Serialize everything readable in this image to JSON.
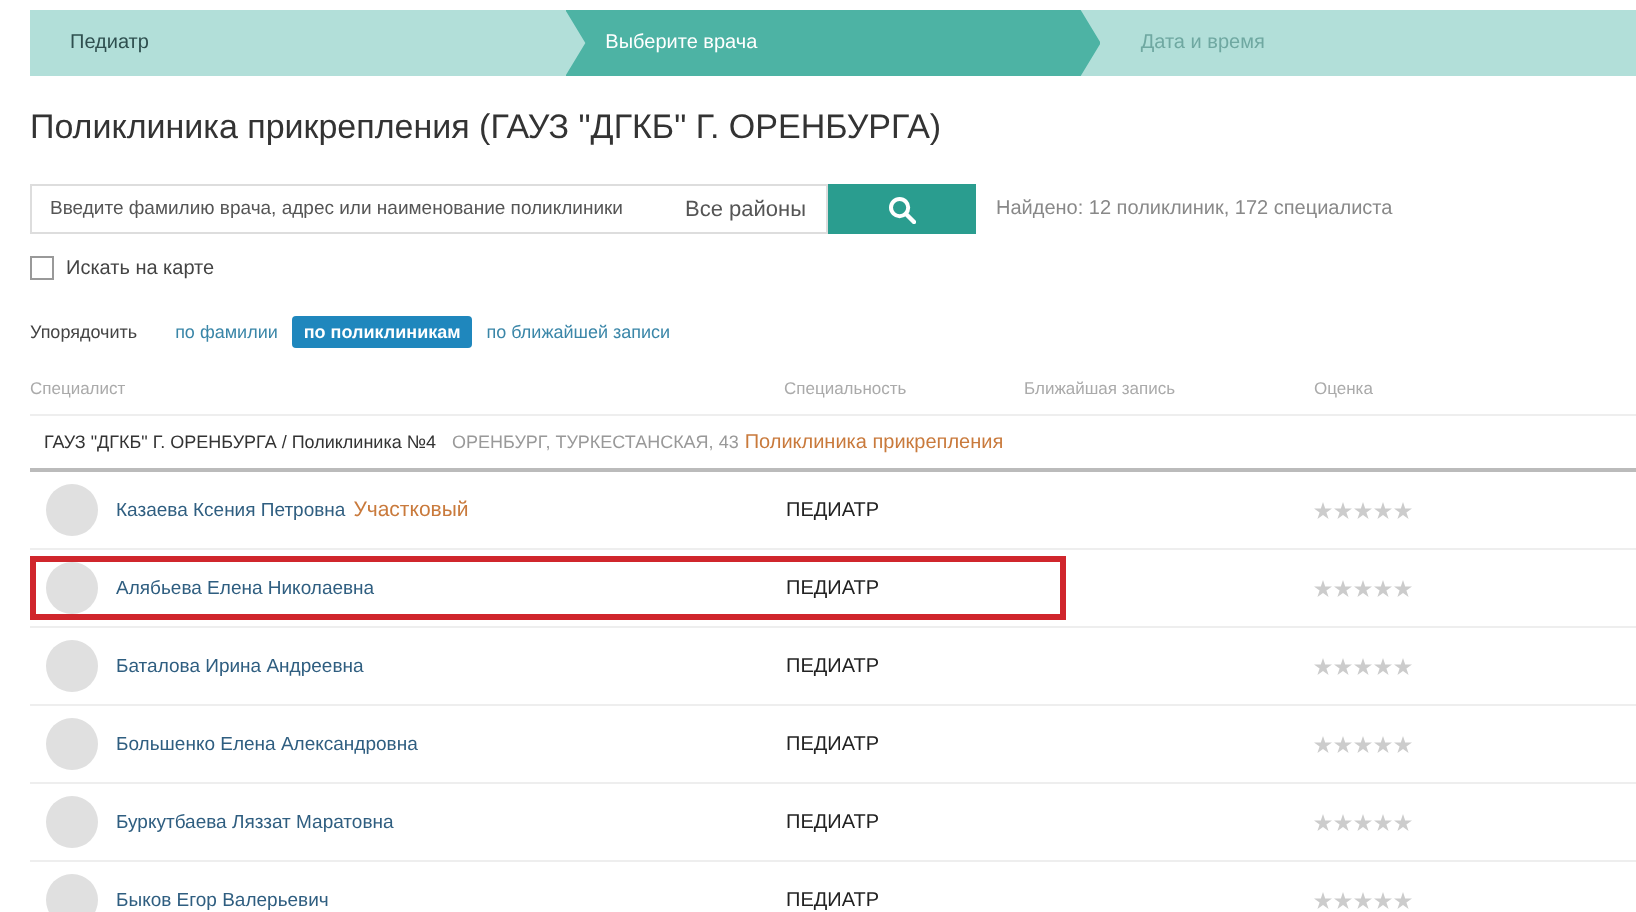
{
  "steps": [
    {
      "label": "Педиатр",
      "selected": false,
      "disabled": false
    },
    {
      "label": "Выберите врача",
      "selected": true,
      "disabled": false
    },
    {
      "label": "Дата и время",
      "selected": false,
      "disabled": true
    }
  ],
  "title": "Поликлиника прикрепления (ГАУЗ \"ДГКБ\" Г. ОРЕНБУРГА)",
  "search": {
    "placeholder": "Введите фамилию врача, адрес или наименование поликлиники",
    "district": "Все районы",
    "found": "Найдено: 12 поликлиник, 172 специалиста"
  },
  "map_checkbox": {
    "label": "Искать на карте",
    "checked": false
  },
  "sort": {
    "label": "Упорядочить",
    "options": [
      {
        "label": "по фамилии",
        "selected": false
      },
      {
        "label": "по поликлиникам",
        "selected": true
      },
      {
        "label": "по ближайшей записи",
        "selected": false
      }
    ]
  },
  "table": {
    "columns": [
      "Специалист",
      "Специальность",
      "Ближайшая запись",
      "Оценка"
    ],
    "group": {
      "name": "ГАУЗ \"ДГКБ\" Г. ОРЕНБУРГА / Поликлиника №4",
      "address": "ОРЕНБУРГ, ТУРКЕСТАНСКАЯ, 43",
      "tag": "Поликлиника прикрепления"
    },
    "rows": [
      {
        "name": "Казаева Ксения Петровна",
        "tag": "Участковый",
        "specialty": "ПЕДИАТР",
        "stars": 0,
        "highlighted": false
      },
      {
        "name": "Алябьева Елена Николаевна",
        "specialty": "ПЕДИАТР",
        "stars": 0,
        "highlighted": true
      },
      {
        "name": "Баталова Ирина Андреевна",
        "specialty": "ПЕДИАТР",
        "stars": 0,
        "highlighted": false
      },
      {
        "name": "Большенко Елена Александровна",
        "specialty": "ПЕДИАТР",
        "stars": 0,
        "highlighted": false
      },
      {
        "name": "Буркутбаева Ляззат Маратовна",
        "specialty": "ПЕДИАТР",
        "stars": 0,
        "highlighted": false
      },
      {
        "name": "Быков Егор Валерьевич",
        "specialty": "ПЕДИАТР",
        "stars": 0,
        "highlighted": false
      }
    ]
  }
}
